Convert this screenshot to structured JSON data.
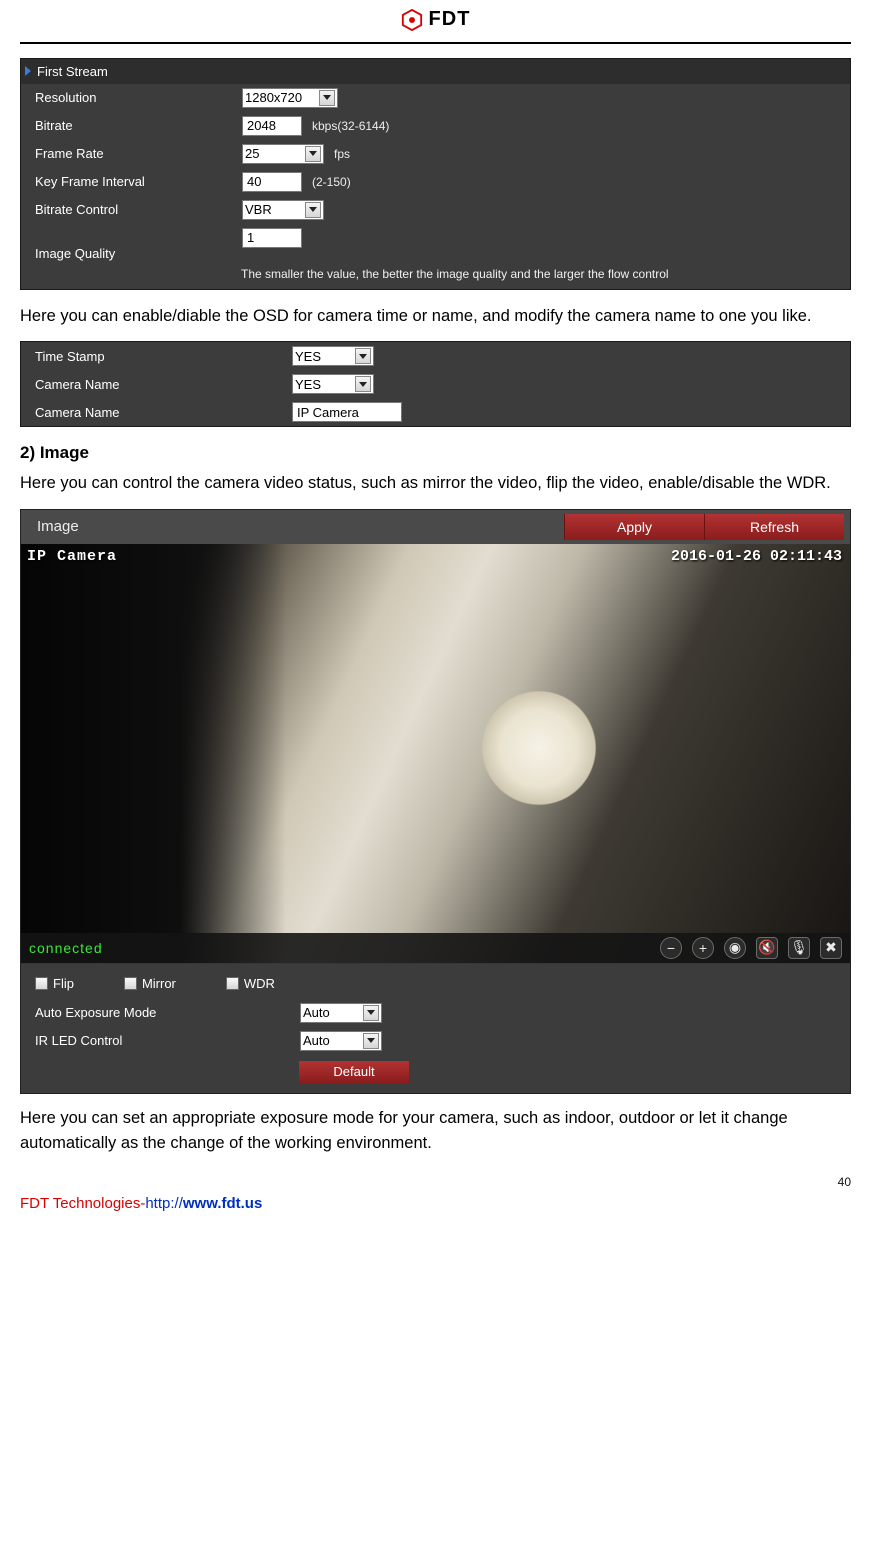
{
  "header": {
    "brand": "FDT"
  },
  "stream_panel": {
    "section": "First Stream",
    "rows": {
      "resolution_label": "Resolution",
      "resolution_value": "1280x720",
      "bitrate_label": "Bitrate",
      "bitrate_value": "2048",
      "bitrate_hint": "kbps(32-6144)",
      "framerate_label": "Frame Rate",
      "framerate_value": "25",
      "framerate_unit": "fps",
      "keyframe_label": "Key Frame Interval",
      "keyframe_value": "40",
      "keyframe_hint": "(2-150)",
      "bitrate_control_label": "Bitrate Control",
      "bitrate_control_value": "VBR",
      "image_quality_label": "Image Quality",
      "image_quality_value": "1",
      "image_quality_hint": "The smaller the value, the better the image quality and the larger the flow control"
    }
  },
  "para1": "Here you can enable/diable the OSD for camera time or name, and modify the camera name to one you like.",
  "osd_panel": {
    "timestamp_label": "Time Stamp",
    "timestamp_value": "YES",
    "camera_name_enable_label": "Camera Name",
    "camera_name_enable_value": "YES",
    "camera_name_label": "Camera Name",
    "camera_name_value": "IP Camera"
  },
  "section2_title": "2) Image",
  "para2": "Here you can control the camera video status, such as mirror the video, flip the video, enable/disable the WDR.",
  "image_block": {
    "title": "Image",
    "apply": "Apply",
    "refresh": "Refresh",
    "osd_name": "IP Camera",
    "osd_time": "2016-01-26 02:11:43",
    "status": "connected",
    "flip": "Flip",
    "mirror": "Mirror",
    "wdr": "WDR",
    "exposure_label": "Auto Exposure Mode",
    "exposure_value": "Auto",
    "ir_label": "IR LED Control",
    "ir_value": "Auto",
    "default_btn": "Default"
  },
  "para3": "Here you can set an appropriate exposure mode for your camera, such as indoor, outdoor or let it change automatically as the change of the working environment.",
  "page_number": "40",
  "footer": {
    "company": "FDT Technologies-",
    "proto": "http://",
    "domain": "www.fdt.us"
  }
}
